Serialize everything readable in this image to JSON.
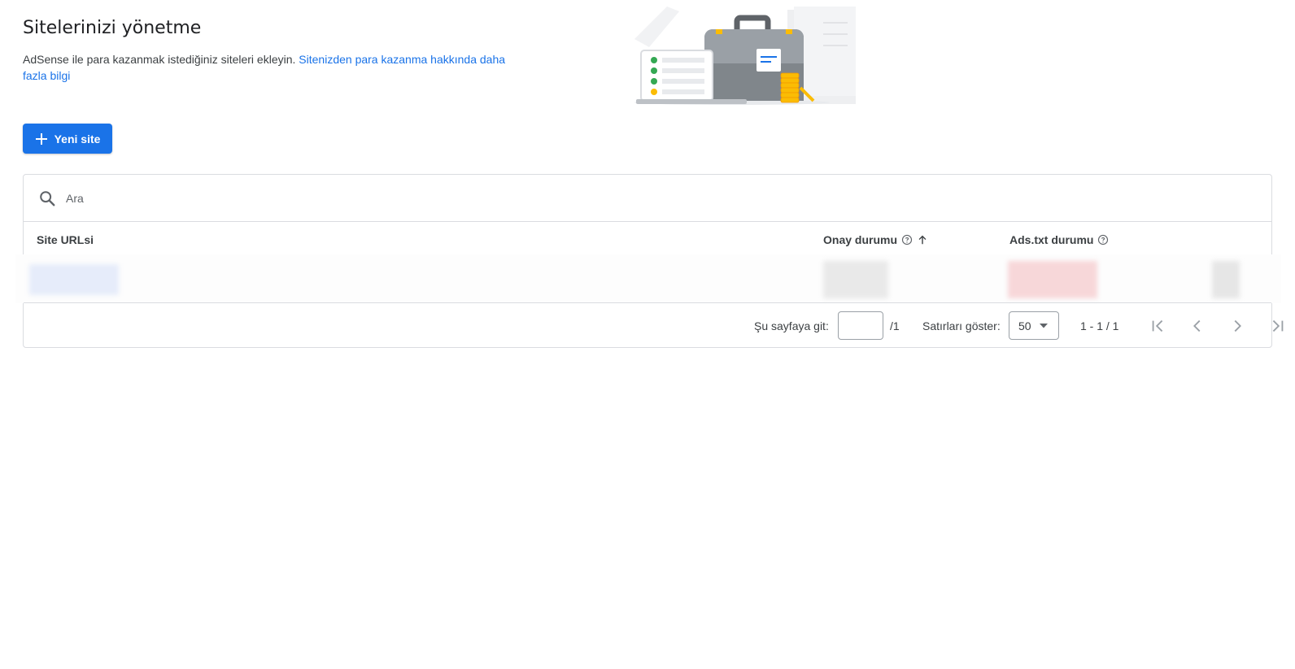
{
  "page": {
    "title": "Sitelerinizi yönetme",
    "description": "AdSense ile para kazanmak istediğiniz siteleri ekleyin.",
    "learn_more_link": "Sitenizden para kazanma hakkında daha fazla bilgi"
  },
  "toolbar": {
    "new_site_label": "Yeni site"
  },
  "search": {
    "placeholder": "Ara"
  },
  "table": {
    "columns": {
      "site_url": "Site URLsi",
      "approval_status": "Onay durumu",
      "adstxt_status": "Ads.txt durumu"
    }
  },
  "pagination": {
    "goto_label": "Şu sayfaya git:",
    "page_value": "",
    "total_pages": "/1",
    "rows_label": "Satırları göster:",
    "rows_value": "50",
    "range": "1 - 1 / 1"
  },
  "icons": {
    "search": "search-icon",
    "add": "plus-icon",
    "help": "help-circle-icon",
    "sort": "arrow-up-icon",
    "dropdown": "caret-down-icon",
    "first": "first-page-icon",
    "prev": "chevron-left-icon",
    "next": "chevron-right-icon",
    "last": "last-page-icon"
  },
  "colors": {
    "primary": "#1a73e8",
    "text": "#202124",
    "border": "#dadce0",
    "muted_icon": "#9aa0a6"
  }
}
